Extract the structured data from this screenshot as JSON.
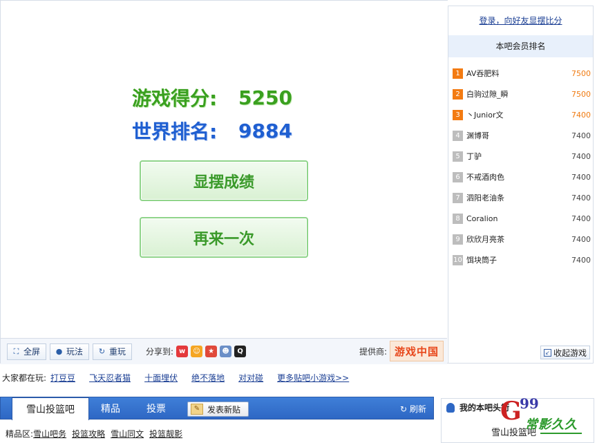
{
  "game": {
    "score_label": "游戏得分:",
    "score_value": "5250",
    "rank_label": "世界排名:",
    "rank_value": "9884",
    "show_button": "显摆成绩",
    "again_button": "再来一次"
  },
  "toolbar": {
    "fullscreen": "全屏",
    "howto": "玩法",
    "replay": "重玩",
    "share_label": "分享到:",
    "share_icons": [
      "weibo-icon",
      "douban-icon",
      "qzone-icon",
      "renren-icon",
      "qq-icon"
    ],
    "provider_label": "提供商:",
    "provider_logo": "游戏中国"
  },
  "sidebar": {
    "login_link": "登录，向好友显摆比分",
    "rank_title": "本吧会员排名",
    "ranking": [
      {
        "rank": "1",
        "name": "AV吞肥料",
        "score": "7500",
        "top": true
      },
      {
        "rank": "2",
        "name": "白驹过隙_瞬",
        "score": "7500",
        "top": true
      },
      {
        "rank": "3",
        "name": "丶Junior文",
        "score": "7400",
        "top": true
      },
      {
        "rank": "4",
        "name": "渊博哥",
        "score": "7400",
        "top": false
      },
      {
        "rank": "5",
        "name": "丁驴",
        "score": "7400",
        "top": false
      },
      {
        "rank": "6",
        "name": "不戒酒肉色",
        "score": "7400",
        "top": false
      },
      {
        "rank": "7",
        "name": "泗阳老油条",
        "score": "7400",
        "top": false
      },
      {
        "rank": "8",
        "name": "Coralion",
        "score": "7400",
        "top": false
      },
      {
        "rank": "9",
        "name": "欣欣月亮茶",
        "score": "7400",
        "top": false
      },
      {
        "rank": "10",
        "name": "饵块筒子",
        "score": "7400",
        "top": false
      }
    ],
    "collapse_button": "收起游戏"
  },
  "playing": {
    "label": "大家都在玩:",
    "games": [
      "打豆豆",
      "飞天忍者猫",
      "十面埋伏",
      "绝不落地",
      "对对碰",
      "更多贴吧小游戏>>"
    ]
  },
  "forum": {
    "active_tab": "雪山投篮吧",
    "tabs": [
      "精品",
      "投票"
    ],
    "post_button": "发表新贴",
    "refresh": "刷新"
  },
  "good_area": {
    "label": "精品区:",
    "links": [
      "雪山吧务",
      "投篮攻略",
      "雪山同文",
      "投篮靓影"
    ]
  },
  "mybar": {
    "title": "我的本吧头衔",
    "bar_name": "雪山投篮吧"
  },
  "watermark": {
    "g": "G",
    "n": "99",
    "text": "常影久久"
  },
  "colors": {
    "score_green": "#3aa01f",
    "rank_blue": "#1f5fd1",
    "nav_blue": "#2e67c4",
    "top_rank_orange": "#f37b12"
  }
}
